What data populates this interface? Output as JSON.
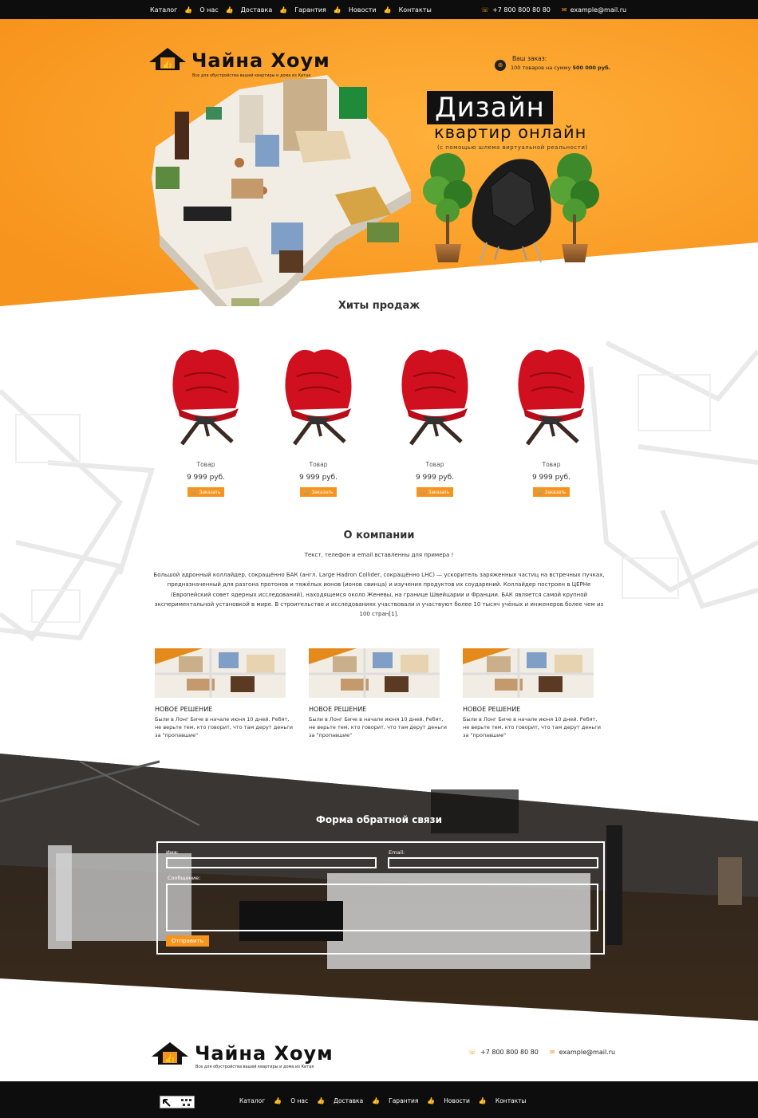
{
  "nav": {
    "items": [
      "Каталог",
      "О нас",
      "Доставка",
      "Гарантия",
      "Новости",
      "Контакты"
    ],
    "separator_icon": "thumbs-up-icon"
  },
  "contacts": {
    "phone": "+7 800 800 80 80",
    "email": "example@mail.ru",
    "phone_icon": "phone-icon",
    "email_icon": "envelope-icon"
  },
  "brand": {
    "name": "Чайна Хоум",
    "tagline": "Все для обустройства вашей квартиры и дома из Китая"
  },
  "order": {
    "label": "Ваш заказ:",
    "summary_prefix": "100 товаров на сумму",
    "summary_amount": "500 000 руб.",
    "icon": "basket-icon"
  },
  "hero": {
    "title_line1": "Дизайн",
    "title_line2": "квартир онлайн",
    "subtitle": "(с помощью шлема виртуальной реальности)"
  },
  "products": {
    "title": "Хиты продаж",
    "button_label": "Заказать",
    "items": [
      {
        "name": "Товар",
        "price": "9 999 руб."
      },
      {
        "name": "Товар",
        "price": "9 999 руб."
      },
      {
        "name": "Товар",
        "price": "9 999 руб."
      },
      {
        "name": "Товар",
        "price": "9 999 руб."
      }
    ]
  },
  "about": {
    "title": "О компании",
    "subtitle": "Текст, телефон и email вставленны для примера !",
    "text": "Большой адронный коллайдер, сокращённо БАК (англ. Large Hadron Collider, сокращённо LHC) — ускоритель заряженных частиц на встречных пучках, предназначенный для разгона протонов и тяжёлых ионов (ионов свинца) и изучения продуктов их соударений. Коллайдер построен в ЦЕРНе (Европейский совет ядерных исследований), находящемся около Женевы, на границе Швейцарии и Франции. БАК является самой крупной экспериментальной установкой в мире. В строительстве и исследованиях участвовали и участвуют более 10 тысяч учёных и инженеров более чем из 100 стран[1]."
  },
  "news": [
    {
      "title": "НОВОЕ РЕШЕНИЕ",
      "text": "Были в Лонг Биче в начале июня 10 дней. Ребят, не верьте тем, кто говорит, что там дерут деньги за \"пропавшие\""
    },
    {
      "title": "НОВОЕ РЕШЕНИЕ",
      "text": "Были в Лонг Биче в начале июня 10 дней. Ребят, не верьте тем, кто говорит, что там дерут деньги за \"пропавшие\""
    },
    {
      "title": "НОВОЕ РЕШЕНИЕ",
      "text": "Были в Лонг Биче в начале июня 10 дней. Ребят, не верьте тем, кто говорит, что там дерут деньги за \"пропавшие\""
    }
  ],
  "feedback": {
    "title": "Форма обратной связи",
    "name_label": "Имя:",
    "email_label": "Email:",
    "message_label": "Сообщение:",
    "submit_label": "Отправить"
  },
  "colors": {
    "accent": "#f7941d",
    "dark": "#0d0d0d",
    "chair_red": "#d0101e"
  }
}
